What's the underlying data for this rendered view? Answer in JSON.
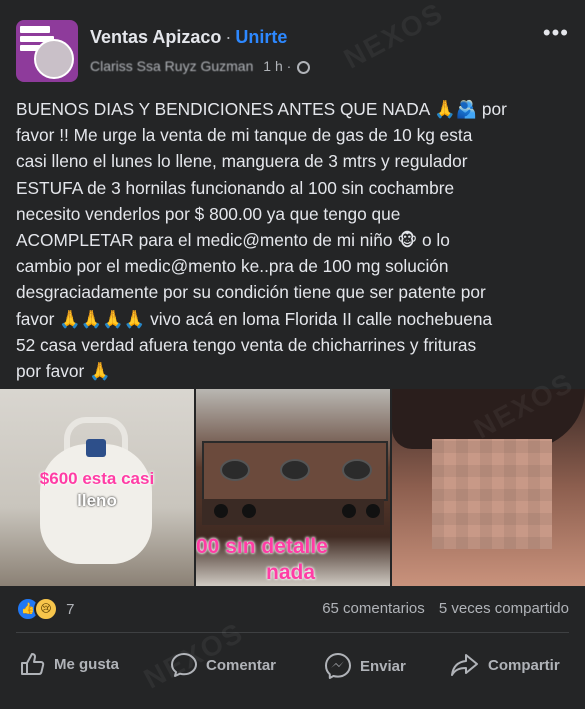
{
  "post": {
    "group_name": "Ventas Apizaco",
    "separator": "·",
    "join_label": "Unirte",
    "author": "Clariss Ssa Ruyz Guzman",
    "time": "1 h",
    "time_separator": "·",
    "more_glyph": "•••",
    "privacy_icon": "globe-icon",
    "avatar_text": [
      "MPRA",
      "NUESTRA",
      "NORA"
    ],
    "text_lines": [
      "BUENOS DIAS Y BENDICIONES ANTES QUE NADA 🙏🫂 por",
      "favor !! Me urge la venta de mi tanque de gas de 10 kg esta",
      "casi lleno el lunes lo llene, manguera de 3 mtrs y regulador",
      "ESTUFA de 3 hornilas funcionando al 100 sin cochambre",
      "necesito venderlos por $ 800.00 ya que tengo que",
      "ACOMPLETAR para el medic@mento de mi niño 🐵  o lo",
      "cambio por el medic@mento ke..pra de 100 mg solución",
      "desgraciadamente por su condición tiene que ser patente por",
      "favor 🙏🙏🙏🙏 vivo acá en loma Florida II calle nochebuena",
      "52 casa verdad afuera tengo venta de chicharrines y frituras",
      "por favor 🙏"
    ]
  },
  "photos": {
    "photo1_caption_line1": "$600 esta casi",
    "photo1_caption_line2": "lleno",
    "photo2_caption_line1": "00 sin detalle",
    "photo2_caption_line2": "nada"
  },
  "stats": {
    "reaction_count": "7",
    "comments": "65 comentarios",
    "shares": "5 veces compartido"
  },
  "actions": {
    "like": "Me gusta",
    "comment": "Comentar",
    "send": "Enviar",
    "share": "Compartir"
  },
  "watermark": "NEXOS"
}
